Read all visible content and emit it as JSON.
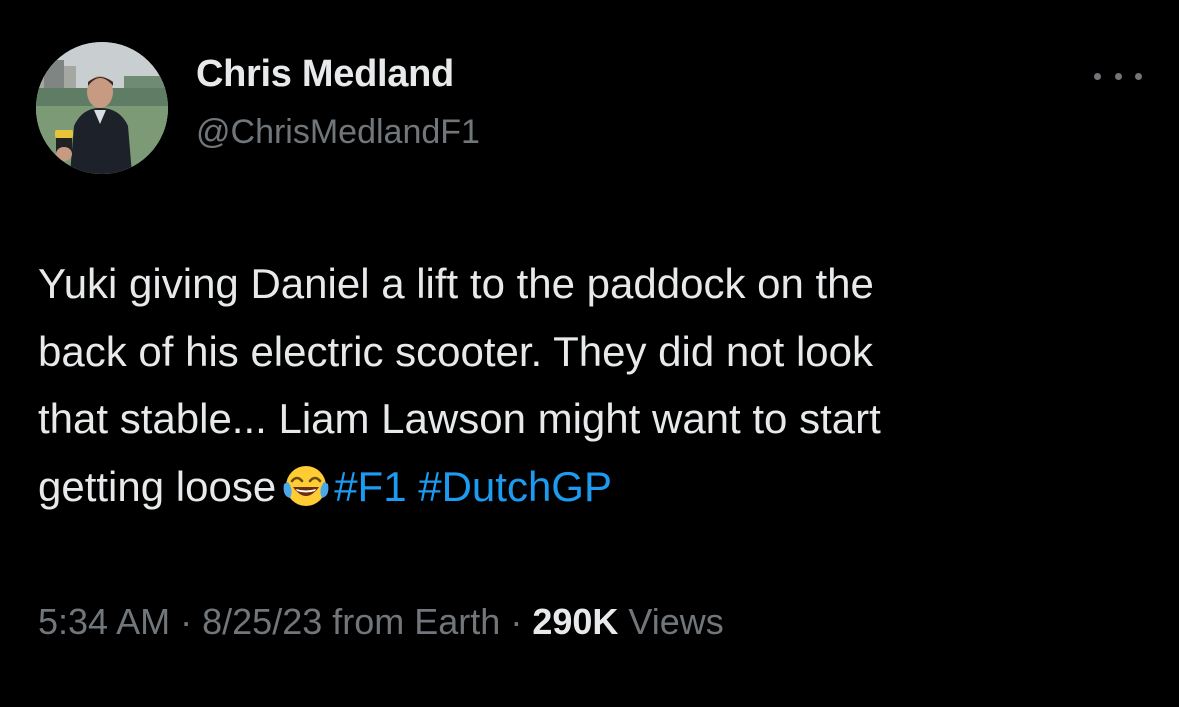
{
  "author": {
    "name": "Chris Medland",
    "handle": "@ChrisMedlandF1"
  },
  "tweet": {
    "lines": [
      "Yuki giving Daniel a lift to the paddock on the",
      "back of his electric scooter. They did not look",
      "that stable... Liam Lawson might want to start",
      "getting loose"
    ],
    "emoji": "face-with-tears-of-joy-emoji",
    "hashtags": [
      "#F1",
      "#DutchGP"
    ]
  },
  "meta": {
    "time": "5:34 AM",
    "sep1": "·",
    "date": "8/25/23",
    "source": "from Earth",
    "sep2": "·",
    "views_count": "290K",
    "views_label": "Views"
  },
  "icons": {
    "more": "more-options-icon"
  },
  "colors": {
    "background": "#000000",
    "text_primary": "#e7e9ea",
    "text_secondary": "#71767b",
    "link": "#1d9bf0"
  }
}
